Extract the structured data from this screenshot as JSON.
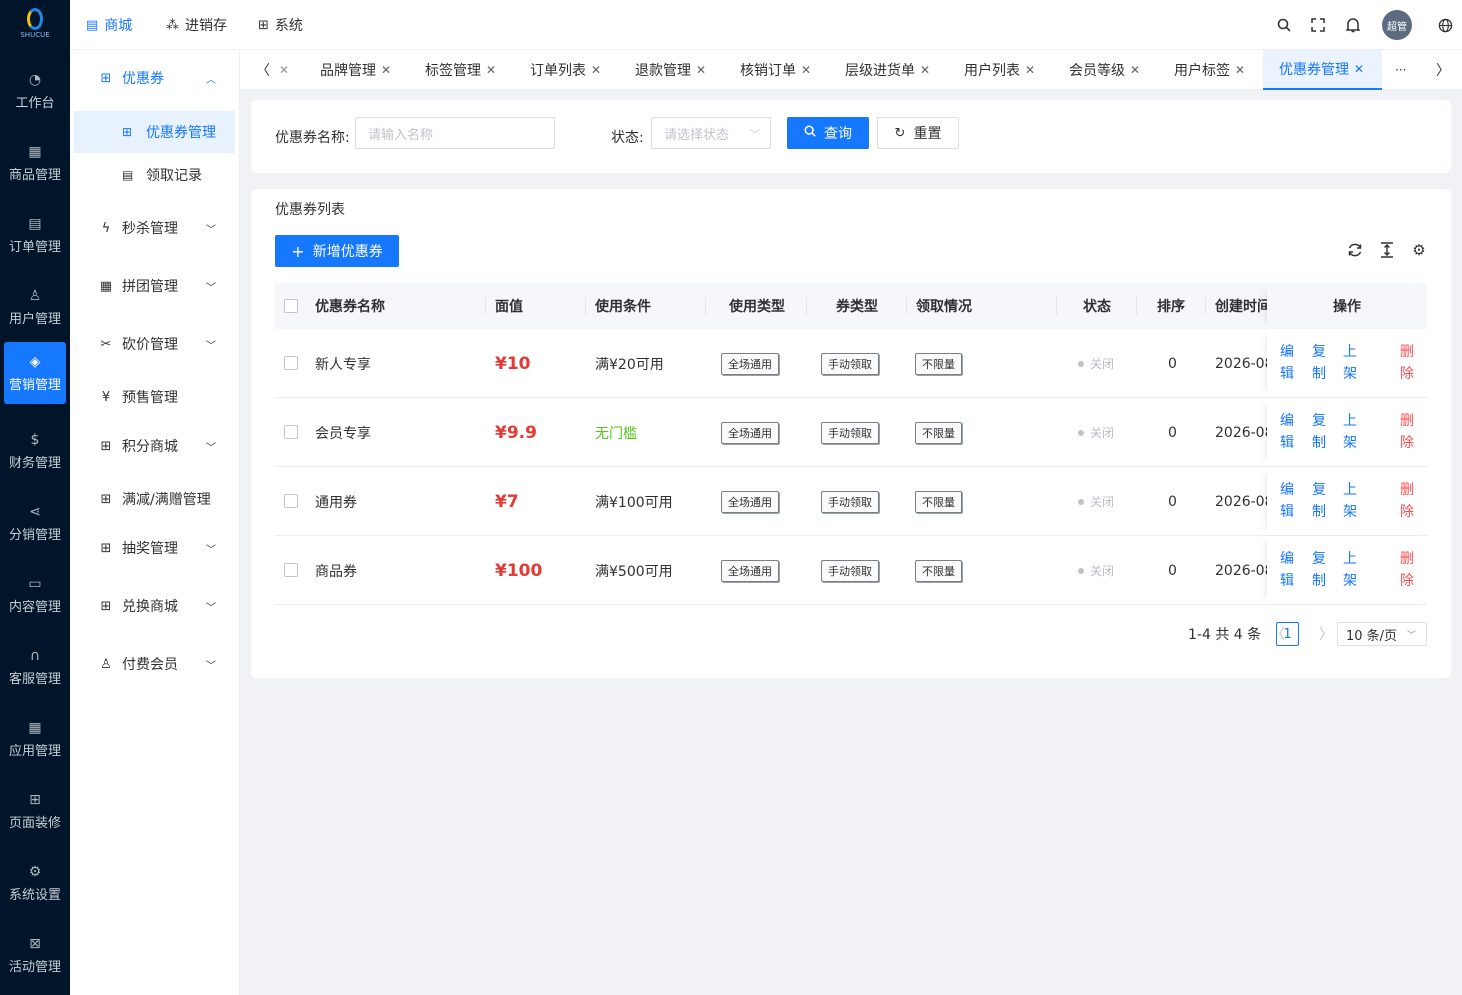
{
  "brand": {
    "logo_text": "SHUCUE"
  },
  "nav": {
    "items": [
      {
        "label": "工作台",
        "icon": "dashboard-icon"
      },
      {
        "label": "商品管理",
        "icon": "grid-icon"
      },
      {
        "label": "订单管理",
        "icon": "document-icon"
      },
      {
        "label": "用户管理",
        "icon": "user-icon"
      },
      {
        "label": "营销管理",
        "icon": "tag-icon"
      },
      {
        "label": "财务管理",
        "icon": "money-icon"
      },
      {
        "label": "分销管理",
        "icon": "share-icon"
      },
      {
        "label": "内容管理",
        "icon": "book-icon"
      },
      {
        "label": "客服管理",
        "icon": "headset-icon"
      },
      {
        "label": "应用管理",
        "icon": "apps-icon"
      },
      {
        "label": "页面装修",
        "icon": "layout-icon"
      },
      {
        "label": "系统设置",
        "icon": "gear-icon"
      },
      {
        "label": "活动管理",
        "icon": "activity-icon"
      }
    ]
  },
  "header": {
    "menus": [
      {
        "label": "商城",
        "icon": "store-icon"
      },
      {
        "label": "进销存",
        "icon": "stock-icon"
      },
      {
        "label": "系统",
        "icon": "system-icon"
      }
    ],
    "avatar_text": "超管"
  },
  "subnav": {
    "group_open": "优惠券",
    "children": [
      "优惠券管理",
      "领取记录"
    ],
    "items": [
      "秒杀管理",
      "拼团管理",
      "砍价管理",
      "预售管理",
      "积分商城",
      "满减/满赠管理",
      "抽奖管理",
      "兑换商城",
      "付费会员"
    ]
  },
  "tabs": [
    "品牌管理",
    "标签管理",
    "订单列表",
    "退款管理",
    "核销订单",
    "层级进货单",
    "用户列表",
    "会员等级",
    "用户标签",
    "优惠券管理"
  ],
  "tabs_more": "···",
  "search": {
    "name_label": "优惠券名称:",
    "name_placeholder": "请输入名称",
    "status_label": "状态:",
    "status_placeholder": "请选择状态",
    "query_label": "查询",
    "reset_label": "重置"
  },
  "list": {
    "title": "优惠券列表",
    "add_label": "新增优惠券",
    "columns": [
      "优惠券名称",
      "面值",
      "使用条件",
      "使用类型",
      "券类型",
      "领取情况",
      "状态",
      "排序",
      "创建时间",
      "操作"
    ],
    "rows": [
      {
        "name": "新人专享",
        "value": "¥10",
        "condition": "满¥20可用",
        "use_type": "全场通用",
        "coupon_type": "手动领取",
        "claim": "不限量",
        "status": "关闭",
        "sort": "0",
        "created": "2026-08"
      },
      {
        "name": "会员专享",
        "value": "¥9.9",
        "condition": "无门槛",
        "use_type": "全场通用",
        "coupon_type": "手动领取",
        "claim": "不限量",
        "status": "关闭",
        "sort": "0",
        "created": "2026-08"
      },
      {
        "name": "通用券",
        "value": "¥7",
        "condition": "满¥100可用",
        "use_type": "全场通用",
        "coupon_type": "手动领取",
        "claim": "不限量",
        "status": "关闭",
        "sort": "0",
        "created": "2026-08"
      },
      {
        "name": "商品券",
        "value": "¥100",
        "condition": "满¥500可用",
        "use_type": "全场通用",
        "coupon_type": "手动领取",
        "claim": "不限量",
        "status": "关闭",
        "sort": "0",
        "created": "2026-08"
      }
    ],
    "ops": [
      [
        "编",
        "辑"
      ],
      [
        "复",
        "制"
      ],
      [
        "上",
        "架"
      ],
      [
        "删",
        "除"
      ]
    ]
  },
  "pagination": {
    "summary": "1-4 共 4 条",
    "current": "1",
    "page_size": "10 条/页"
  },
  "colors": {
    "primary": "#1677ff",
    "danger": "#e53935",
    "success": "#52c41a",
    "nav_bg": "#001529"
  }
}
